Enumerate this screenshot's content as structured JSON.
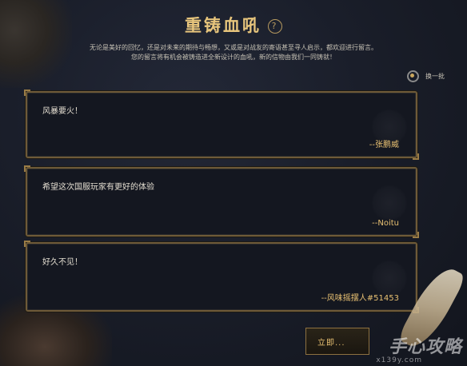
{
  "header": {
    "title": "重铸血吼",
    "help_symbol": "?",
    "description_line1": "无论是美好的回忆，还是对未来的期待与畅想，又或是对战友的寄语甚至寻人启示，都欢迎进行留言。",
    "description_line2": "您的留言将有机会被铸造进全新设计的血吼，新的信物由我们一同铸就！"
  },
  "toolbar": {
    "refresh_label": "换一批",
    "refresh_icon": "refresh-icon"
  },
  "messages": [
    {
      "text": "风暴要火！",
      "author": "--张鹏威"
    },
    {
      "text": "希望这次国服玩家有更好的体验",
      "author": "--Noitu"
    },
    {
      "text": "好久不见！",
      "author": "--风味摇摆人#51453"
    }
  ],
  "submit": {
    "label": "立即..."
  },
  "watermark": {
    "site": "手心攻略",
    "sub": "x139y.com"
  },
  "colors": {
    "accent_gold": "#e7c57c",
    "author_gold": "#e8c072",
    "card_border": "#6e5a38",
    "background": "#171b26"
  }
}
